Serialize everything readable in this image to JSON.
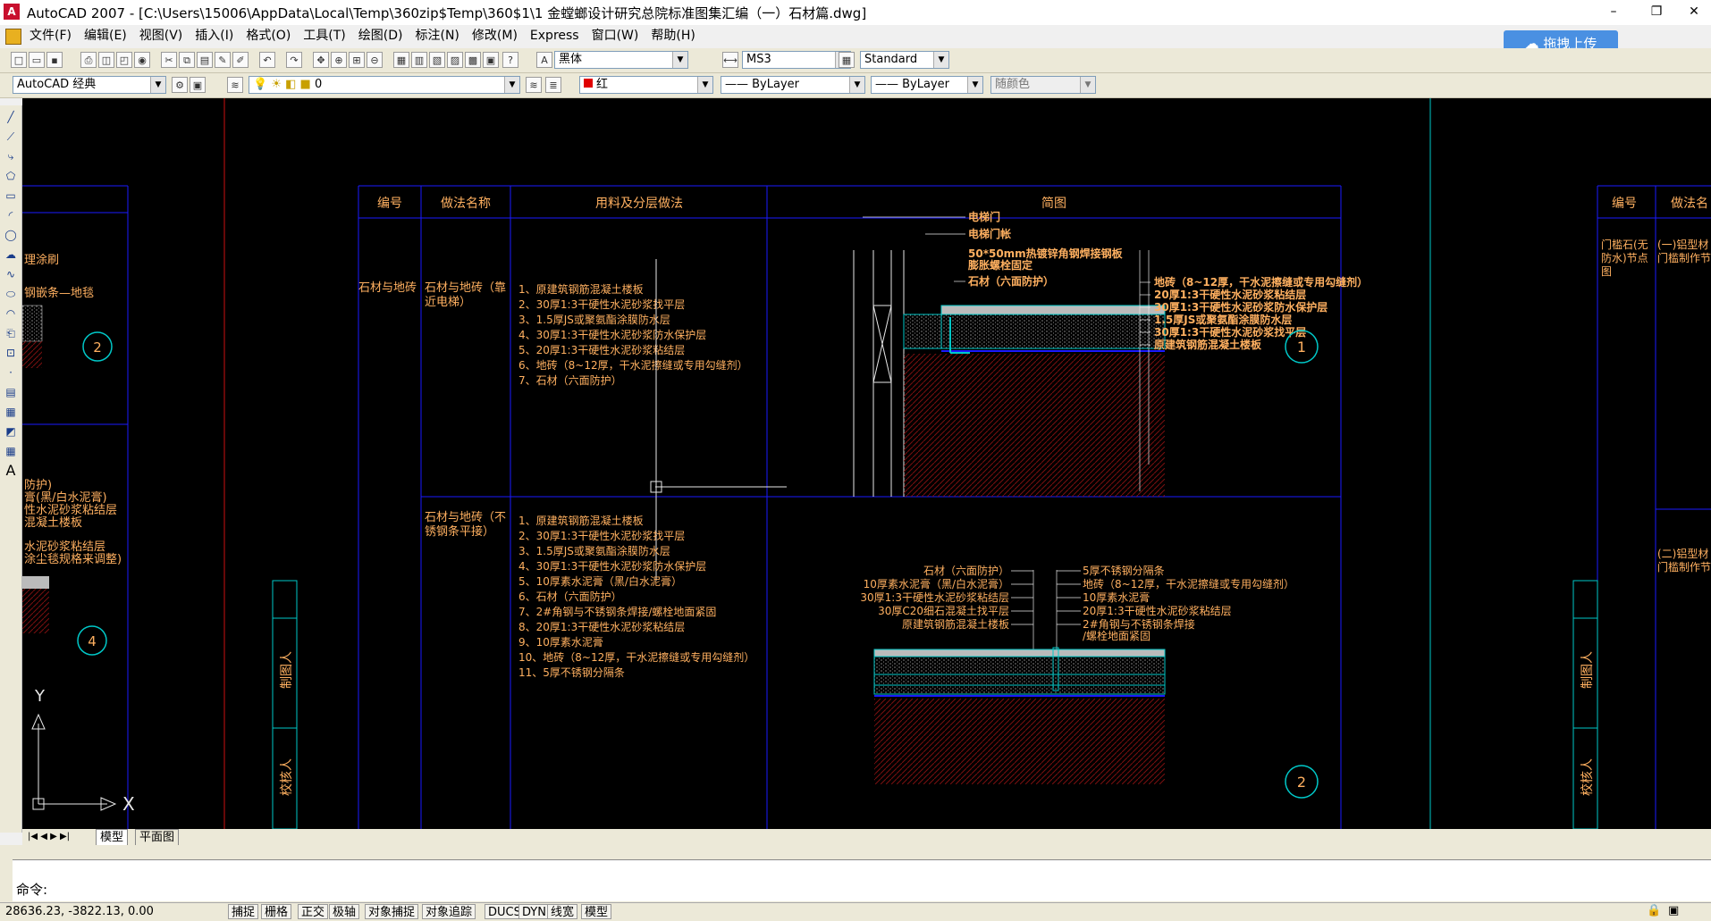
{
  "window": {
    "title": "AutoCAD 2007 - [C:\\Users\\15006\\AppData\\Local\\Temp\\360zip$Temp\\360$1\\1 金螳螂设计研究总院标准图集汇编（一）石材篇.dwg]",
    "icon_label": "A",
    "restore": "❐",
    "minimize": "–",
    "close": "✕"
  },
  "menu": [
    "文件(F)",
    "编辑(E)",
    "视图(V)",
    "插入(I)",
    "格式(O)",
    "工具(T)",
    "绘图(D)",
    "标注(N)",
    "修改(M)",
    "Express",
    "窗口(W)",
    "帮助(H)"
  ],
  "cloud_button": "拖拽上传",
  "toolbar": {
    "font_combo": "黑体",
    "dimstyle_combo": "MS3",
    "textstyle_combo": "Standard",
    "workspace_combo": "AutoCAD 经典",
    "layer_combo": "0",
    "color_combo": "红",
    "linetype_combo": "—— ByLayer",
    "lineweight_combo": "—— ByLayer",
    "plotstyle_combo": "随颜色"
  },
  "colors": {
    "cyan": "#00c8c8",
    "blue": "#1a1aff",
    "orange": "#ffb060",
    "red": "#d01010",
    "white": "#e8e8e8"
  },
  "drawing": {
    "headers": [
      "编号",
      "做法名称",
      "用料及分层做法",
      "简图"
    ],
    "right_headers": [
      "编号",
      "做法名"
    ],
    "row1": {
      "category": "石材与地砖",
      "name": "石材与地砖（靠近电梯）",
      "steps": [
        "1、原建筑钢筋混凝土楼板",
        "2、30厚1:3干硬性水泥砂浆找平层",
        "3、1.5厚JS或聚氨酯涂膜防水层",
        "4、30厚1:3干硬性水泥砂浆防水保护层",
        "5、20厚1:3干硬性水泥砂浆粘结层",
        "6、地砖（8~12厚，干水泥擦缝或专用勾缝剂）",
        "7、石材（六面防护）"
      ],
      "labels_left": [
        "电梯门",
        "电梯门帐",
        "50*50mm热镀锌角钢焊接钢板",
        "膨胀螺栓固定",
        "石材（六面防护）"
      ],
      "labels_right": [
        "地砖（8~12厚，干水泥擦缝或专用勾缝剂）",
        "20厚1:3干硬性水泥砂浆粘结层",
        "30厚1:3干硬性水泥砂浆防水保护层",
        "1.5厚JS或聚氨酯涂膜防水层",
        "30厚1:3干硬性水泥砂浆找平层",
        "原建筑钢筋混凝土楼板"
      ],
      "number": "1"
    },
    "row2": {
      "name": "石材与地砖（不锈钢条平接）",
      "steps": [
        "1、原建筑钢筋混凝土楼板",
        "2、30厚1:3干硬性水泥砂浆找平层",
        "3、1.5厚JS或聚氨酯涂膜防水层",
        "4、30厚1:3干硬性水泥砂浆防水保护层",
        "5、10厚素水泥膏（黑/白水泥膏）",
        "6、石材（六面防护）",
        "7、2#角钢与不锈钢条焊接/螺栓地面紧固",
        "8、20厚1:3干硬性水泥砂浆粘结层",
        "9、10厚素水泥膏",
        "10、地砖（8~12厚，干水泥擦缝或专用勾缝剂）",
        "11、5厚不锈钢分隔条"
      ],
      "labels_left": [
        "石材（六面防护）",
        "10厚素水泥膏（黑/白水泥膏）",
        "30厚1:3干硬性水泥砂浆粘结层",
        "30厚C20细石混凝土找平层",
        "原建筑钢筋混凝土楼板"
      ],
      "labels_right": [
        "5厚不锈钢分隔条",
        "地砖（8~12厚，干水泥擦缝或专用勾缝剂）",
        "10厚素水泥膏",
        "20厚1:3干硬性水泥砂浆粘结层",
        "2#角钢与不锈钢条焊接",
        "/螺栓地面紧固"
      ],
      "number": "2"
    },
    "left_partial": [
      "理涂刷",
      "钢嵌条—地毯",
      "防护)",
      "膏(黑/白水泥膏)",
      "性水泥砂浆粘结层",
      "混凝土楼板",
      "水泥砂浆粘结层",
      "涂尘毯规格来调整)"
    ],
    "left_numbers": [
      "2",
      "4"
    ],
    "right_partial": [
      "门槛石(无",
      "防水)节点",
      "图",
      "(一)铝型材",
      "门槛制作节",
      "(二)铝型材",
      "门槛制作节"
    ],
    "side_labels": [
      "制图人",
      "校核人"
    ],
    "ucs": {
      "x": "X",
      "y": "Y"
    }
  },
  "tabs": {
    "nav": "|◀ ◀ ▶ ▶|",
    "model": "模型",
    "layout": "平面图"
  },
  "command": {
    "prompt": "命令:"
  },
  "status": {
    "coords": "28636.23, -3822.13, 0.00",
    "buttons": [
      "捕捉",
      "栅格",
      "正交",
      "极轴",
      "对象捕捉",
      "对象追踪",
      "DUCS",
      "DYN",
      "线宽",
      "模型"
    ]
  }
}
